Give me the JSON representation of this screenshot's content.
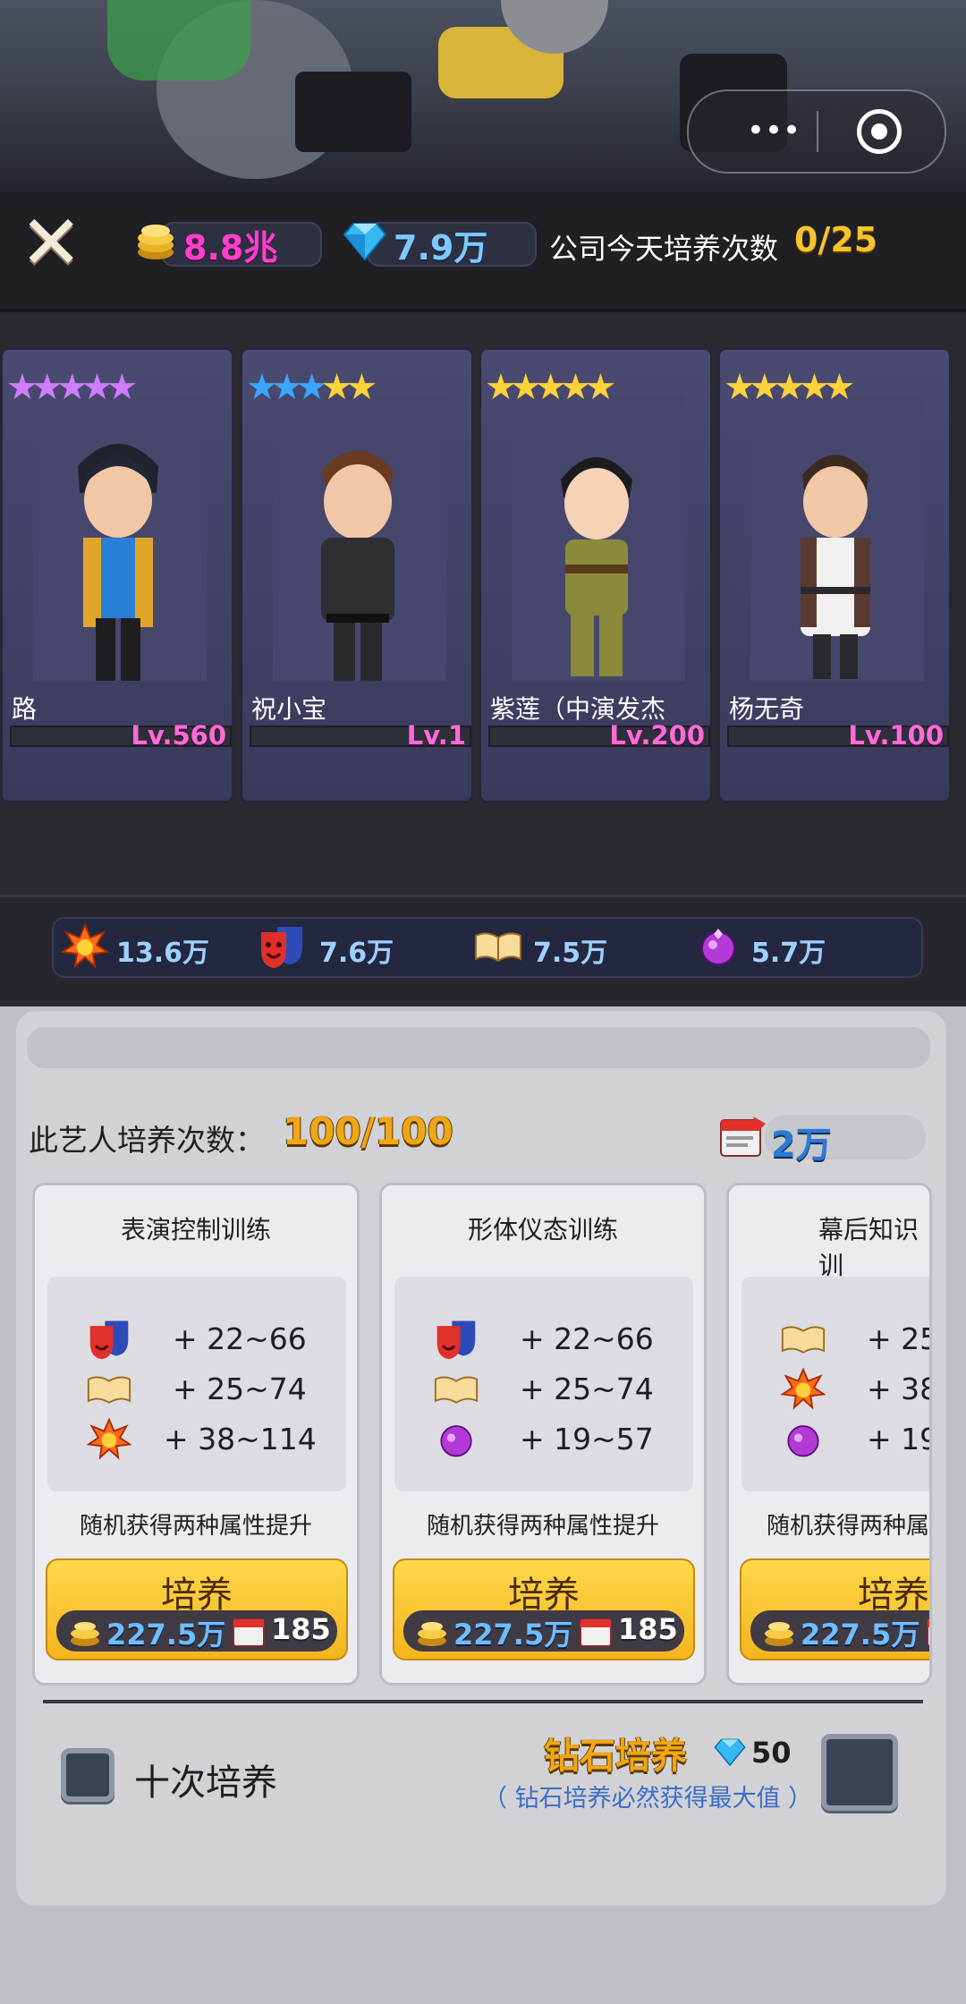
{
  "header": {
    "coins": "8.8兆",
    "diamonds": "7.9万",
    "today_label": "公司今天培养次数",
    "today_value": "0/25"
  },
  "artists": [
    {
      "name": "路",
      "level": "Lv.560",
      "stars": 5,
      "star_color": "#d07cff"
    },
    {
      "name": "祝小宝",
      "level": "Lv.1",
      "stars": 5,
      "star_color": "#ffd23a",
      "blue_stars": 3
    },
    {
      "name": "紫莲（中演发杰",
      "level": "Lv.200",
      "stars": 5,
      "star_color": "#ffd23a"
    },
    {
      "name": "杨无奇",
      "level": "Lv.100",
      "stars": 5,
      "star_color": "#ffd23a"
    }
  ],
  "stats": [
    {
      "icon": "explosion-icon",
      "value": "13.6万"
    },
    {
      "icon": "theater-mask-icon",
      "value": "7.6万"
    },
    {
      "icon": "book-icon",
      "value": "7.5万"
    },
    {
      "icon": "purple-gem-icon",
      "value": "5.7万"
    }
  ],
  "training": {
    "times_label": "此艺人培养次数：",
    "times_value": "100/100",
    "ticket_value": "2万",
    "cards": [
      {
        "title": "表演控制训练",
        "rows": [
          {
            "icon": "theater-mask-icon",
            "range": "+ 22~66"
          },
          {
            "icon": "book-icon",
            "range": "+ 25~74"
          },
          {
            "icon": "explosion-icon",
            "range": "+ 38~114"
          }
        ],
        "note": "随机获得两种属性提升",
        "button": "培养",
        "coin_cost": "227.5万",
        "ticket_cost": "185"
      },
      {
        "title": "形体仪态训练",
        "rows": [
          {
            "icon": "theater-mask-icon",
            "range": "+ 22~66"
          },
          {
            "icon": "book-icon",
            "range": "+ 25~74"
          },
          {
            "icon": "purple-gem-icon",
            "range": "+ 19~57"
          }
        ],
        "note": "随机获得两种属性提升",
        "button": "培养",
        "coin_cost": "227.5万",
        "ticket_cost": "185"
      },
      {
        "title": "幕后知识训",
        "rows": [
          {
            "icon": "book-icon",
            "range": "+ 25"
          },
          {
            "icon": "explosion-icon",
            "range": "+ 38"
          },
          {
            "icon": "purple-gem-icon",
            "range": "+ 19"
          }
        ],
        "note": "随机获得两种属",
        "button": "培养",
        "coin_cost": "227.5万",
        "ticket_cost": "18"
      }
    ],
    "ten_times_label": "十次培养",
    "diamond_label": "钻石培养",
    "diamond_cost": "50",
    "diamond_note": "（ 钻石培养必然获得最大值 ）"
  }
}
